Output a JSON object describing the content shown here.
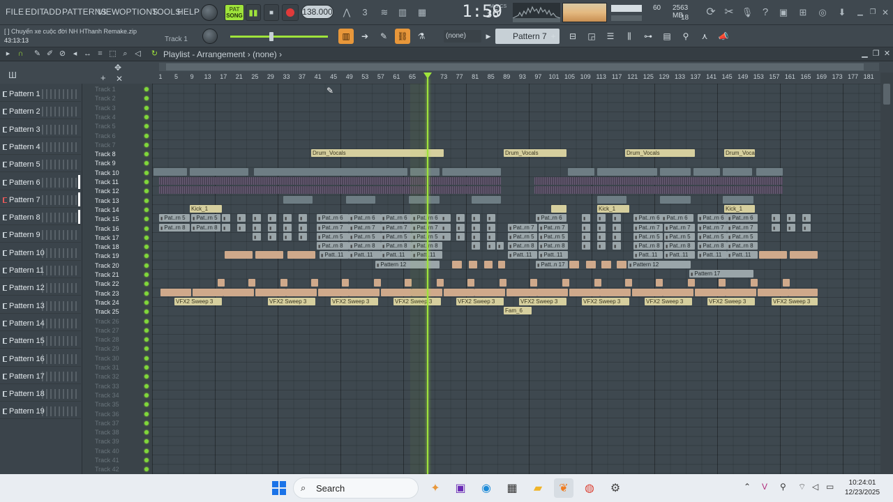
{
  "menu": [
    "FILE",
    "EDIT",
    "ADD",
    "PATTERNS",
    "VIEW",
    "OPTIONS",
    "TOOLS",
    "HELP"
  ],
  "transport": {
    "song_label": "SONG",
    "pat_label": "PAT",
    "play_symbol": "▮▮",
    "stop_symbol": "■",
    "tempo": "138.000"
  },
  "time": {
    "main": "1:59",
    "frac": "36",
    "sub": "M:S:CS"
  },
  "cpu": {
    "cpu_value": "60",
    "memory": "2563 MB",
    "polyphony": "18"
  },
  "project": {
    "name": "[ ] Chuyến xe cuộc đời NH HThanh Remake.zip",
    "elapsed": "43:13:13",
    "track_hint": "Track 1"
  },
  "toolbar2": {
    "snap_select": "(none)",
    "pattern_select": "Pattern 7"
  },
  "playlist": {
    "title": "Playlist - Arrangement",
    "arrangement": "(none)"
  },
  "ruler": [
    1,
    5,
    9,
    13,
    17,
    21,
    25,
    29,
    33,
    37,
    41,
    45,
    49,
    53,
    57,
    61,
    65,
    69,
    73,
    77,
    81,
    85,
    89,
    93,
    97,
    101,
    105,
    109,
    113,
    117,
    121,
    125,
    129,
    133,
    137,
    141,
    145,
    149,
    153,
    157,
    161,
    165,
    169,
    173,
    177,
    181
  ],
  "patterns": [
    "Pattern 1",
    "Pattern 2",
    "Pattern 3",
    "Pattern 4",
    "Pattern 5",
    "Pattern 6",
    "Pattern 7",
    "Pattern 8",
    "Pattern 9",
    "Pattern 10",
    "Pattern 11",
    "Pattern 12",
    "Pattern 13",
    "Pattern 14",
    "Pattern 15",
    "Pattern 16",
    "Pattern 17",
    "Pattern 18",
    "Pattern 19"
  ],
  "tracks": [
    "Track 1",
    "Track 2",
    "Track 3",
    "Track 4",
    "Track 5",
    "Track 6",
    "Track 7",
    "Track 8",
    "Track 9",
    "Track 10",
    "Track 11",
    "Track 12",
    "Track 13",
    "Track 14",
    "Track 15",
    "Track 16",
    "Track 17",
    "Track 18",
    "Track 19",
    "Track 20",
    "Track 21",
    "Track 22",
    "Track 23",
    "Track 24",
    "Track 25",
    "Track 26",
    "Track 27",
    "Track 28",
    "Track 29",
    "Track 30",
    "Track 31",
    "Track 32",
    "Track 33",
    "Track 34",
    "Track 35",
    "Track 36",
    "Track 37",
    "Track 38",
    "Track 39",
    "Track 40",
    "Track 41",
    "Track 42"
  ],
  "clips": {
    "vocal_a": "Drum_Vocals",
    "pattern_short5": "Pat..rn 5",
    "pattern_short6": "Pat..rn 6",
    "pattern_short7": "Pat..rn 7",
    "pattern_short8": "Pat..rn 8",
    "pattern_short11": "Patt..11",
    "pattern_short17": "Patt..n 17",
    "pattern12": "Pattern 12",
    "pattern17": "Pattern 17",
    "vfx": "VFX2 Sweep 3",
    "fill": "Fam_6",
    "kick": "Kick_1"
  },
  "taskbar": {
    "search": "Search",
    "time": "10:24:01",
    "date": "12/23/2025"
  }
}
